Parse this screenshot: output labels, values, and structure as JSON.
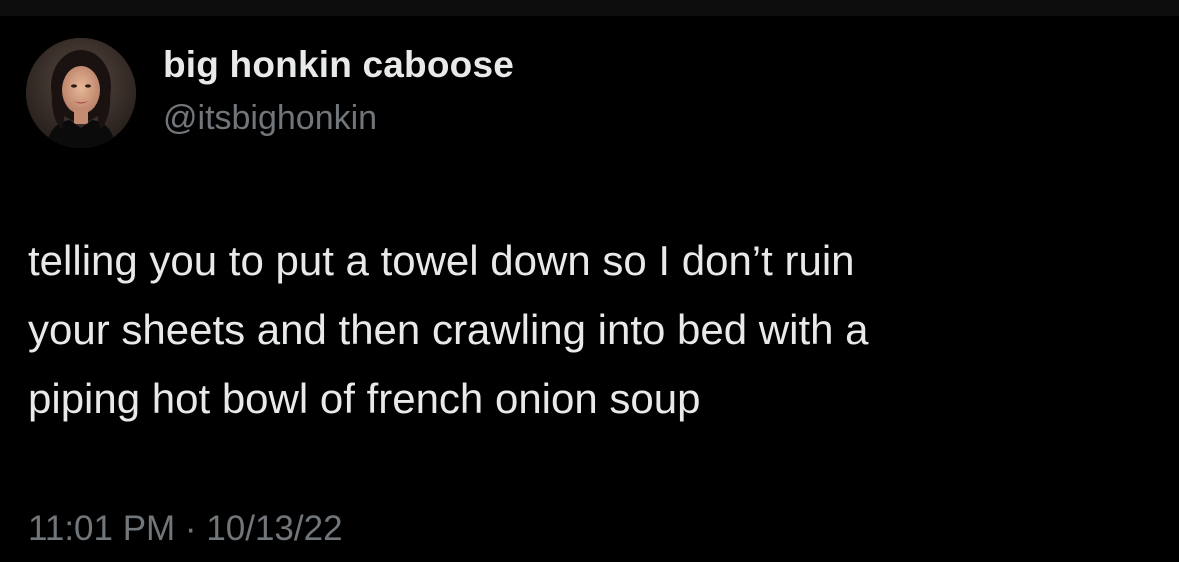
{
  "author": {
    "display_name": "big honkin caboose",
    "handle": "@itsbighonkin"
  },
  "tweet": {
    "lines": [
      "telling you to put a towel down so I don’t ruin",
      "your sheets and then crawling into bed with a",
      "piping hot bowl of french onion soup"
    ]
  },
  "meta": {
    "timestamp": "11:01 PM · 10/13/22"
  },
  "colors": {
    "background": "#000000",
    "primary_text": "#e7e9ea",
    "secondary_text": "#71767b"
  }
}
